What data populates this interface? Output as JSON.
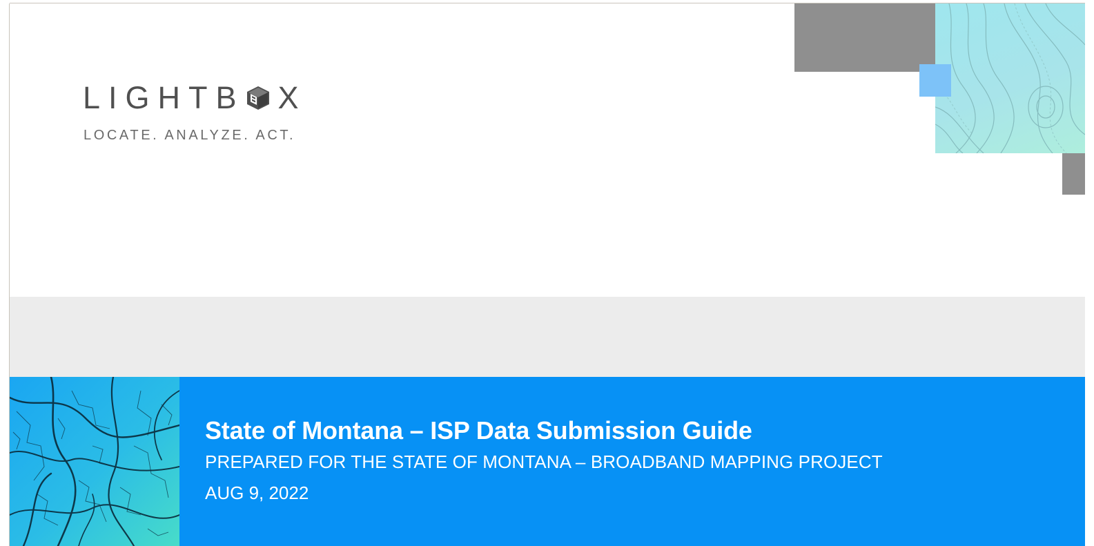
{
  "logo": {
    "word_before": "LIGHTB",
    "word_after": "X",
    "icon": "cube-icon",
    "tagline": "LOCATE. ANALYZE. ACT."
  },
  "document": {
    "title": "State of Montana – ISP Data Submission Guide",
    "subtitle": "PREPARED FOR THE STATE OF MONTANA – BROADBAND MAPPING PROJECT",
    "date": "AUG 9, 2022"
  },
  "colors": {
    "band_blue": "#0791f5",
    "band_gray": "#ececec",
    "deco_gray": "#8f8f8f",
    "deco_light_blue": "#7dc2f8",
    "logo_gray": "#505050"
  }
}
